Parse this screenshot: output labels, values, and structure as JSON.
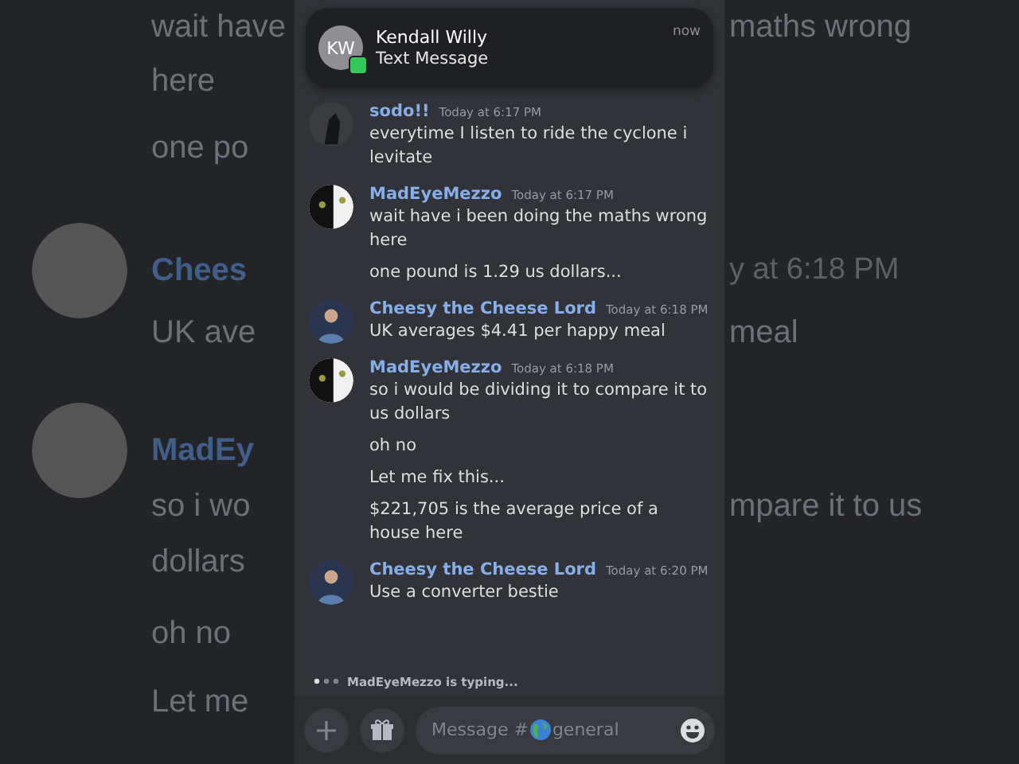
{
  "background": {
    "left": [
      {
        "kind": "text",
        "text": "wait have"
      },
      {
        "kind": "text",
        "text": "here"
      },
      {
        "kind": "text",
        "text": "one po"
      },
      {
        "kind": "author",
        "text": "Chees"
      },
      {
        "kind": "text",
        "text": "UK ave"
      },
      {
        "kind": "author",
        "text": "MadEy"
      },
      {
        "kind": "text",
        "text": "so i wo"
      },
      {
        "kind": "text",
        "text": "dollars"
      },
      {
        "kind": "text",
        "text": "oh no"
      },
      {
        "kind": "text",
        "text": "Let me"
      }
    ],
    "right": [
      {
        "kind": "text",
        "text": "maths wrong"
      },
      {
        "kind": "time",
        "text": "y at 6:18 PM"
      },
      {
        "kind": "text",
        "text": "meal"
      },
      {
        "kind": "text",
        "text": "mpare it to us"
      }
    ]
  },
  "notification": {
    "initials": "KW",
    "sender": "Kendall Willy",
    "subtitle": "Text Message",
    "time": "now"
  },
  "messages": [
    {
      "author": "sodo!!",
      "time": "Today at 6:17 PM",
      "avatar": {
        "kind": "dark"
      },
      "lines": [
        "everytime I listen to ride the cyclone i levitate"
      ]
    },
    {
      "author": "MadEyeMezzo",
      "time": "Today at 6:17 PM",
      "avatar": {
        "kind": "cat"
      },
      "lines": [
        "wait have i been doing the maths wrong here",
        "one pound is 1.29 us dollars..."
      ]
    },
    {
      "author": "Cheesy the Cheese Lord",
      "time": "Today at 6:18 PM",
      "avatar": {
        "kind": "person"
      },
      "lines": [
        "UK averages $4.41 per happy meal"
      ]
    },
    {
      "author": "MadEyeMezzo",
      "time": "Today at 6:18 PM",
      "avatar": {
        "kind": "cat"
      },
      "lines": [
        "so i would be dividing it to compare it to us dollars",
        "oh no",
        "Let me fix this...",
        "$221,705 is the average price of a house here"
      ]
    },
    {
      "author": "Cheesy the Cheese Lord",
      "time": "Today at 6:20 PM",
      "avatar": {
        "kind": "person"
      },
      "lines": [
        "Use a converter bestie"
      ]
    }
  ],
  "typing": "MadEyeMezzo is typing...",
  "composer": {
    "hint": "Message #",
    "channel": "general"
  }
}
